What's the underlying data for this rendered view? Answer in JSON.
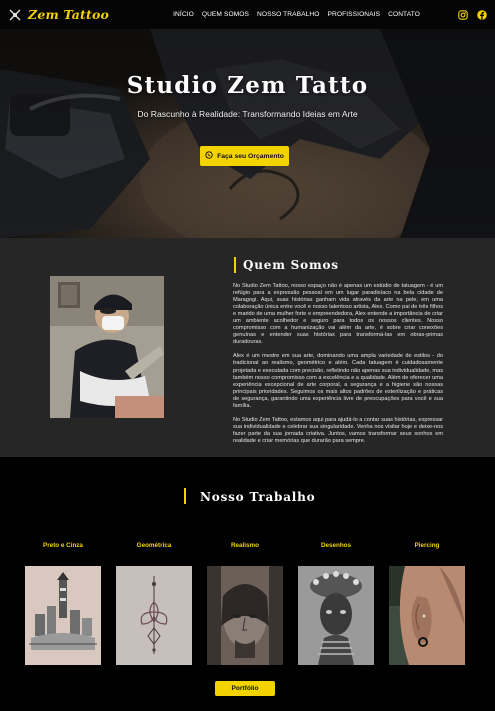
{
  "nav": {
    "brand": "Zem Tattoo",
    "items": [
      {
        "label": "INÍCIO"
      },
      {
        "label": "QUEM SOMOS"
      },
      {
        "label": "NOSSO TRABALHO"
      },
      {
        "label": "PROFISSIONAIS"
      },
      {
        "label": "CONTATO"
      }
    ]
  },
  "hero": {
    "title": "Studio Zem Tatto",
    "subtitle": "Do Rascunho à Realidade: Transformando Ideias em Arte",
    "cta_label": "Faça seu Orçamento"
  },
  "about": {
    "title": "Quem Somos",
    "paragraphs": [
      "No Studio Zem Tattoo, nosso espaço não é apenas um estúdio de tatuagem - é um refúgio para a expressão pessoal em um lugar paradisíaco na bela cidade de Maragogi. Aqui, suas histórias ganham vida através da arte na pele, em uma colaboração única entre você e nosso talentoso artista, Alex. Como pai de três filhos e marido de uma mulher forte e empreendedora, Alex entende a importância de criar um ambiente acolhedor e seguro para todos os nossos clientes. Nosso compromisso com a humanização vai além da arte, é sobre criar conexões genuínas e entender suas histórias para transformá-las em obras-primas duradouras.",
      "Alex é um mestre em sua arte, dominando uma ampla variedade de estilos - do tradicional ao realismo, geométrico e além. Cada tatuagem é cuidadosamente projetada e executada com precisão, refletindo não apenas sua individualidade, mas também nosso compromisso com a excelência e a qualidade. Além de oferecer uma experiência excepcional de arte corporal, a segurança e a higiene são nossas principais prioridades. Seguimos os mais altos padrões de esterilização e práticas de segurança, garantindo uma experiência livre de preocupações para você e sua família.",
      "No Studio Zem Tattoo, estamos aqui para ajudá-lo a contar suas histórias, expressar sua individualidade e celebrar sua singularidade. Venha nos visitar hoje e deixe-nos fazer parte da sua jornada criativa. Juntos, vamos transformar seus sonhos em realidade e criar memórias que durarão para sempre."
    ]
  },
  "work": {
    "title": "Nosso Trabalho",
    "categories": [
      {
        "label": "Preto e Cinza"
      },
      {
        "label": "Geométrica"
      },
      {
        "label": "Realismo"
      },
      {
        "label": "Desenhos"
      },
      {
        "label": "Piercing"
      }
    ],
    "button_label": "Portfólio"
  },
  "colors": {
    "accent": "#f2d300",
    "nav_bg": "#050505",
    "about_bg": "#262626",
    "work_bg": "#000000"
  },
  "icons": [
    "tattoo-machine-icon",
    "instagram-icon",
    "facebook-icon",
    "whatsapp-icon"
  ]
}
